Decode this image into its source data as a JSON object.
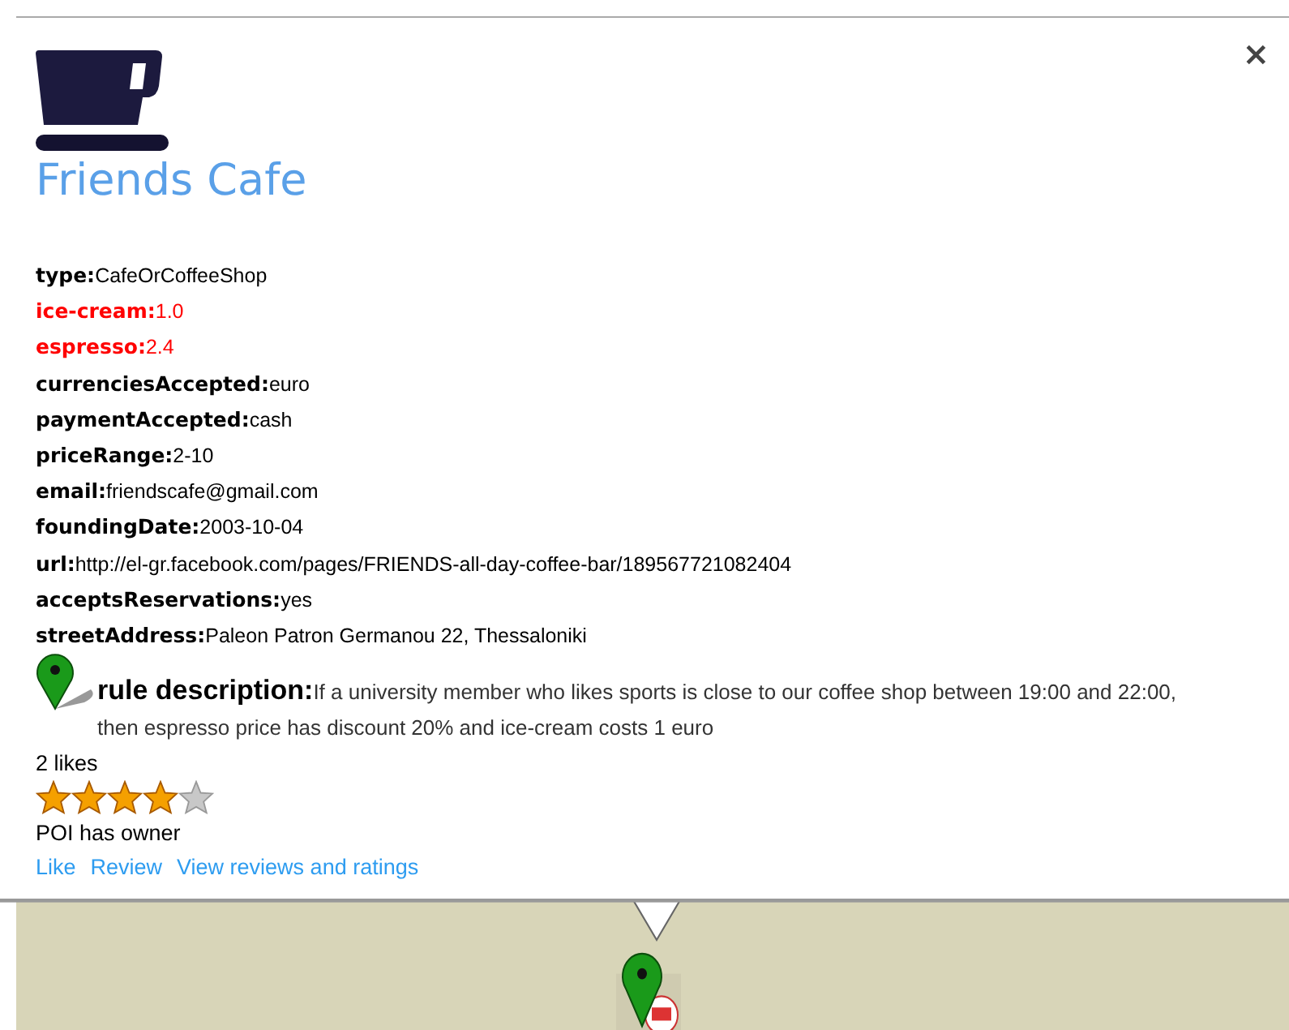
{
  "close": "×",
  "title": "Friends Cafe",
  "properties": [
    {
      "key": "type:",
      "value": "CafeOrCoffeeShop",
      "highlighted": false
    },
    {
      "key": "ice-cream:",
      "value": "1.0",
      "highlighted": true
    },
    {
      "key": "espresso:",
      "value": "2.4",
      "highlighted": true
    },
    {
      "key": "currenciesAccepted:",
      "value": "euro",
      "highlighted": false
    },
    {
      "key": "paymentAccepted:",
      "value": "cash",
      "highlighted": false
    },
    {
      "key": "priceRange:",
      "value": "2-10",
      "highlighted": false
    },
    {
      "key": "email:",
      "value": "friendscafe@gmail.com",
      "highlighted": false
    },
    {
      "key": "foundingDate:",
      "value": "2003-10-04",
      "highlighted": false
    },
    {
      "key": "url:",
      "value": "http://el-gr.facebook.com/pages/FRIENDS-all-day-coffee-bar/189567721082404",
      "highlighted": false
    },
    {
      "key": "acceptsReservations:",
      "value": "yes",
      "highlighted": false
    },
    {
      "key": "streetAddress:",
      "value": "Paleon Patron Germanou 22, Thessaloniki",
      "highlighted": false
    }
  ],
  "rule": {
    "label": "rule description:",
    "text": "If a university member who likes sports is close to our coffee shop between 19:00 and 22:00, then espresso price has discount 20% and ice-cream costs 1 euro"
  },
  "likes": "2 likes",
  "rating": {
    "stars": 4
  },
  "owner": "POI has owner",
  "links": [
    "Like",
    "Review",
    "View reviews and ratings"
  ]
}
